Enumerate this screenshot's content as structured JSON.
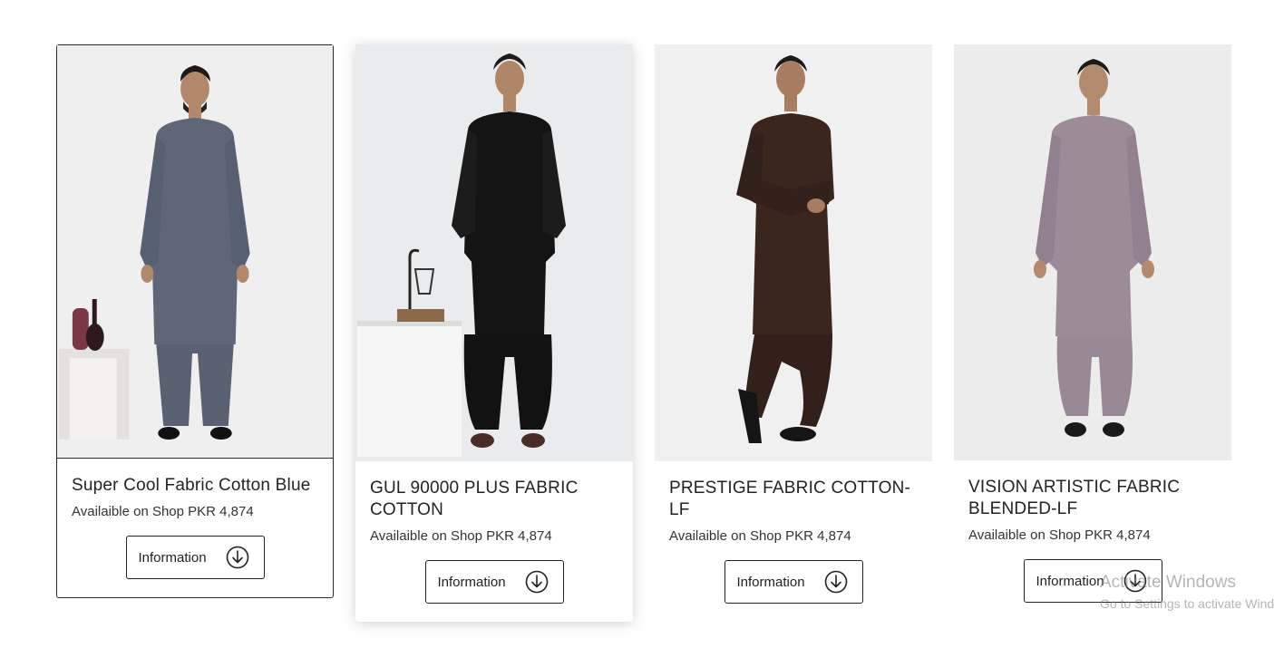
{
  "products": [
    {
      "title": "Super Cool Fabric Cotton Blue",
      "availability": "Availaible on Shop PKR 4,874",
      "button_label": "Information",
      "outfit_color": "#5e6677",
      "prop": "vases"
    },
    {
      "title": "GUL 90000 PLUS FABRIC COTTON",
      "availability": "Availaible on Shop PKR 4,874",
      "button_label": "Information",
      "outfit_color": "#151515",
      "prop": "lamp"
    },
    {
      "title": "PRESTIGE FABRIC COTTON-LF",
      "availability": "Availaible on Shop PKR 4,874",
      "button_label": "Information",
      "outfit_color": "#3a261c",
      "prop": "none"
    },
    {
      "title": "VISION ARTISTIC FABRIC BLENDED-LF",
      "availability": "Availaible on Shop PKR 4,874",
      "button_label": "Information",
      "outfit_color": "#9d8c98",
      "prop": "none"
    }
  ],
  "icons": {
    "download": "download-circle-icon"
  },
  "watermark": {
    "line1": "Activate Windows",
    "line2": "Go to Settings to activate Windows."
  }
}
